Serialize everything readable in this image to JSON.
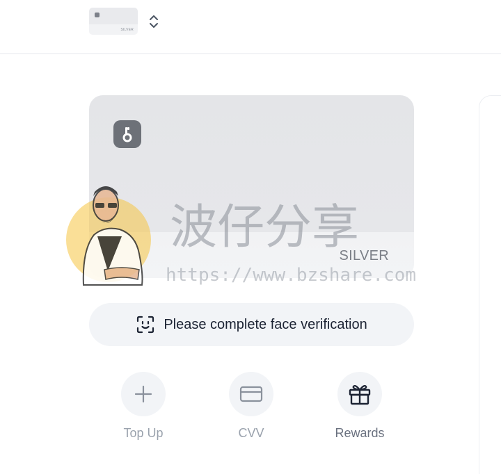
{
  "topbar": {
    "card_switcher": {
      "tier": "SILVER",
      "arrows_icon": "chevron-up-down-icon"
    }
  },
  "card": {
    "tier": "SILVER",
    "logo_icon": "card-brand-logo-icon",
    "logo_color": "#6d7178"
  },
  "verification": {
    "icon": "face-scan-icon",
    "text": "Please complete face verification"
  },
  "actions": [
    {
      "label": "Top Up",
      "icon": "plus-icon"
    },
    {
      "label": "CVV",
      "icon": "credit-card-icon"
    },
    {
      "label": "Rewards",
      "icon": "gift-icon"
    }
  ],
  "watermark": {
    "chinese": "波仔分享",
    "url": "https://www.bzshare.com"
  },
  "colors": {
    "pill_background": "#f2f4f7",
    "text_primary": "#1c2333",
    "text_muted": "#6b7280",
    "watermark_badge": "#f5c542"
  }
}
